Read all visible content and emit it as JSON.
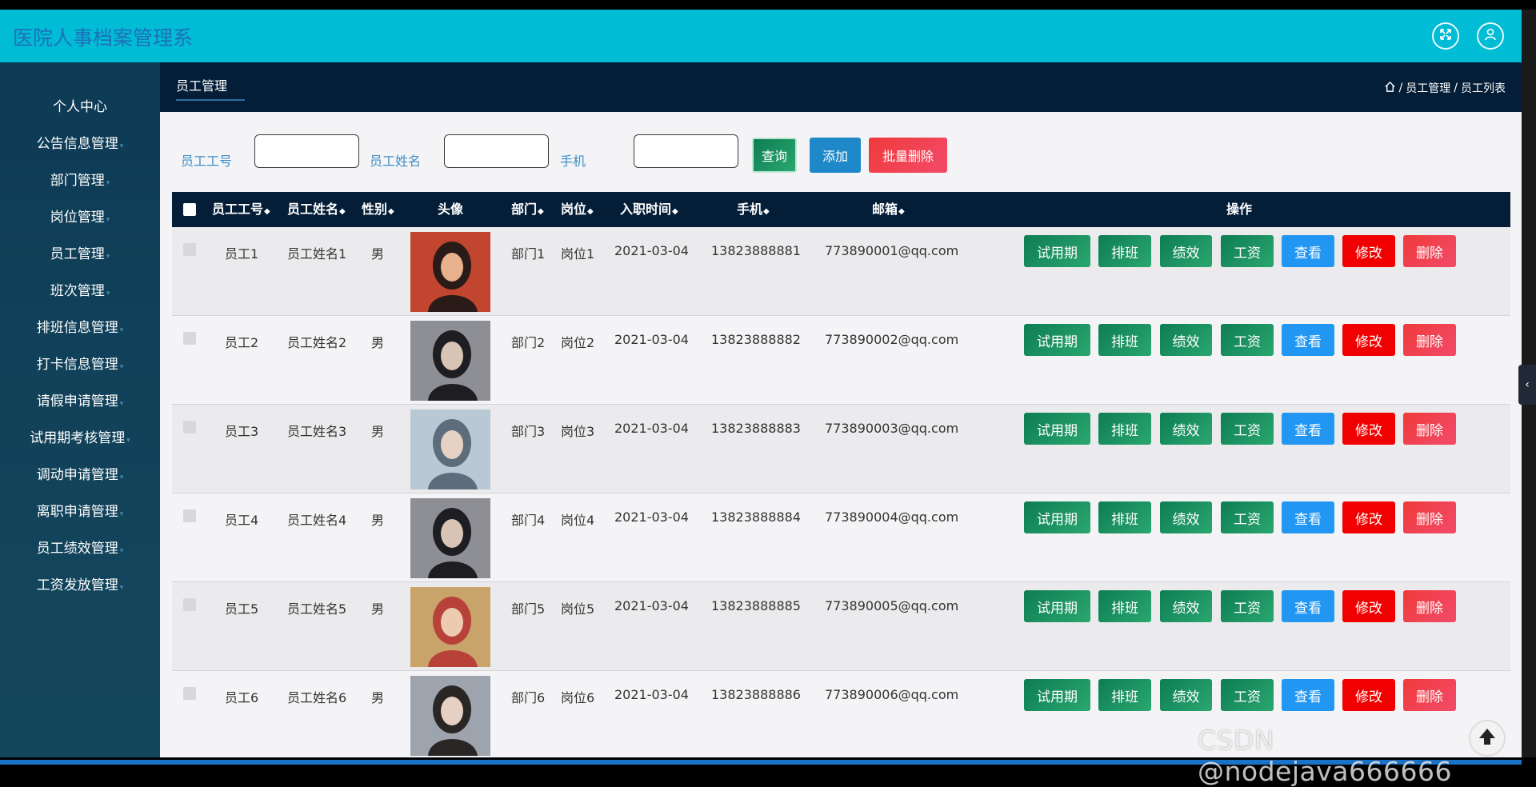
{
  "app_title": "医院人事档案管理系",
  "header_icons": [
    "fullscreen-icon",
    "user-icon"
  ],
  "sidebar": {
    "items": [
      {
        "label": "个人中心",
        "has_arrow": false
      },
      {
        "label": "公告信息管理",
        "has_arrow": true
      },
      {
        "label": "部门管理",
        "has_arrow": true
      },
      {
        "label": "岗位管理",
        "has_arrow": true
      },
      {
        "label": "员工管理",
        "has_arrow": true
      },
      {
        "label": "班次管理",
        "has_arrow": true
      },
      {
        "label": "排班信息管理",
        "has_arrow": true
      },
      {
        "label": "打卡信息管理",
        "has_arrow": true
      },
      {
        "label": "请假申请管理",
        "has_arrow": true
      },
      {
        "label": "试用期考核管理",
        "has_arrow": true
      },
      {
        "label": "调动申请管理",
        "has_arrow": true
      },
      {
        "label": "离职申请管理",
        "has_arrow": true
      },
      {
        "label": "员工绩效管理",
        "has_arrow": true
      },
      {
        "label": "工资发放管理",
        "has_arrow": true
      }
    ],
    "arrow_glyph": "▾"
  },
  "tab": {
    "label": "员工管理"
  },
  "breadcrumb": {
    "sep1": "/",
    "item1": "员工管理",
    "sep2": "/",
    "item2": "员工列表"
  },
  "search": {
    "label_id": "员工工号",
    "label_name": "员工姓名",
    "label_phone": "手机",
    "value_id": "",
    "value_name": "",
    "value_phone": "",
    "query_btn": "查询",
    "add_btn": "添加",
    "batch_delete_btn": "批量删除"
  },
  "table": {
    "headers": {
      "id": "员工工号",
      "name": "员工姓名",
      "gender": "性别",
      "avatar": "头像",
      "dept": "部门",
      "post": "岗位",
      "join_date": "入职时间",
      "phone": "手机",
      "email": "邮箱",
      "ops": "操作"
    },
    "sort_glyph": "◆",
    "actions": {
      "probation": "试用期",
      "schedule": "排班",
      "performance": "绩效",
      "salary": "工资",
      "view": "查看",
      "edit": "修改",
      "delete": "删除"
    },
    "rows": [
      {
        "id": "员工1",
        "name": "员工姓名1",
        "gender": "男",
        "dept": "部门1",
        "post": "岗位1",
        "join_date": "2021-03-04",
        "phone": "13823888881",
        "email": "773890001@qq.com"
      },
      {
        "id": "员工2",
        "name": "员工姓名2",
        "gender": "男",
        "dept": "部门2",
        "post": "岗位2",
        "join_date": "2021-03-04",
        "phone": "13823888882",
        "email": "773890002@qq.com"
      },
      {
        "id": "员工3",
        "name": "员工姓名3",
        "gender": "男",
        "dept": "部门3",
        "post": "岗位3",
        "join_date": "2021-03-04",
        "phone": "13823888883",
        "email": "773890003@qq.com"
      },
      {
        "id": "员工4",
        "name": "员工姓名4",
        "gender": "男",
        "dept": "部门4",
        "post": "岗位4",
        "join_date": "2021-03-04",
        "phone": "13823888884",
        "email": "773890004@qq.com"
      },
      {
        "id": "员工5",
        "name": "员工姓名5",
        "gender": "男",
        "dept": "部门5",
        "post": "岗位5",
        "join_date": "2021-03-04",
        "phone": "13823888885",
        "email": "773890005@qq.com"
      },
      {
        "id": "员工6",
        "name": "员工姓名6",
        "gender": "男",
        "dept": "部门6",
        "post": "岗位6",
        "join_date": "2021-03-04",
        "phone": "13823888886",
        "email": "773890006@qq.com"
      }
    ]
  },
  "colors": {
    "header_bg": "#00bcd4",
    "sidebar_bg": "#0d3a55",
    "table_header_bg": "#041e38",
    "btn_green": "#1e8a5a",
    "btn_blue": "#2196f3",
    "btn_red": "#ff0000",
    "btn_pink": "#f0464f"
  },
  "watermark": "CSDN @nodejava666666"
}
